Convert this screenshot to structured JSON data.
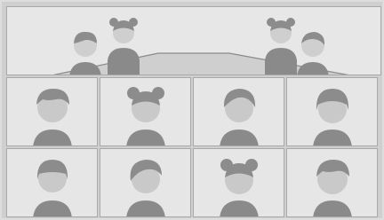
{
  "colors": {
    "background": "#dddddd",
    "panel": "#e6e6e6",
    "border": "#a9a9a9",
    "avatar_face": "#c9c9c9",
    "avatar_hair": "#8c8c8c",
    "avatar_body": "#8a8a8a"
  },
  "room": {
    "icons": [
      "avatar-icon",
      "avatar-icon",
      "avatar-icon",
      "avatar-icon"
    ]
  },
  "grid": {
    "tiles": [
      {
        "hair": "wavy-short"
      },
      {
        "hair": "buns"
      },
      {
        "hair": "side-part"
      },
      {
        "hair": "bob"
      },
      {
        "hair": "bowl"
      },
      {
        "hair": "side-swept"
      },
      {
        "hair": "buns"
      },
      {
        "hair": "wavy-short"
      }
    ]
  }
}
